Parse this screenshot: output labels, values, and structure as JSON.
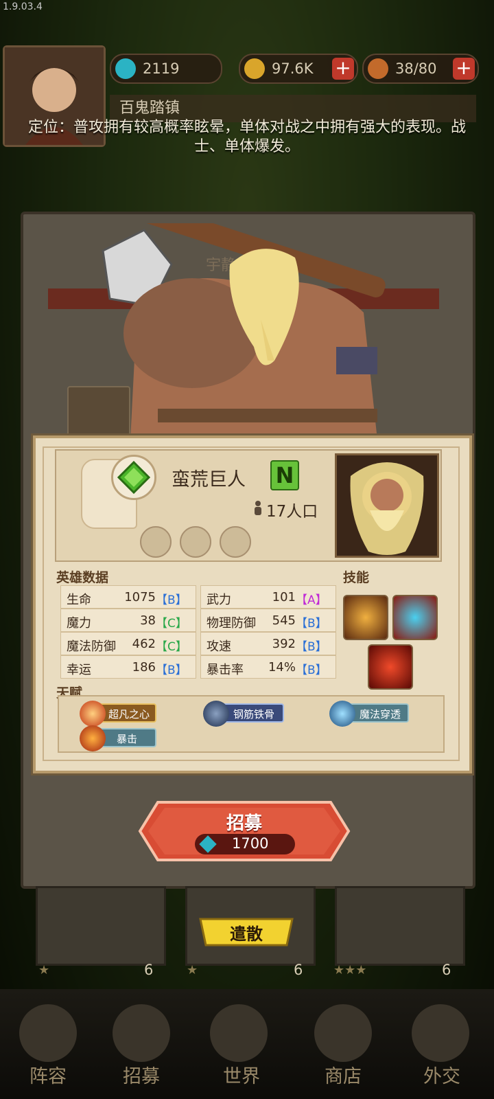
{
  "version": "1.9.03.4",
  "resources": {
    "diamonds": "2119",
    "gold": "97.6K",
    "food": "38/80",
    "plus": "+"
  },
  "location": "百鬼踏镇",
  "description": "定位：普攻拥有较高概率眩晕，单体对战之中拥有强大的表现。战士、单体爆发。",
  "back_panel_title": "宇静",
  "hero": {
    "name": "蛮荒巨人",
    "rarity": "N",
    "population": "17人口"
  },
  "stats_title": "英雄数据",
  "skills_title": "技能",
  "talents_title": "天赋",
  "stats": [
    {
      "name": "生命",
      "value": "1075",
      "grade": "【B】",
      "color": "#2a6fd6"
    },
    {
      "name": "武力",
      "value": "101",
      "grade": "【A】",
      "color": "#c02ad6"
    },
    {
      "name": "魔力",
      "value": "38",
      "grade": "【C】",
      "color": "#2aa84a"
    },
    {
      "name": "物理防御",
      "value": "545",
      "grade": "【B】",
      "color": "#2a6fd6"
    },
    {
      "name": "魔法防御",
      "value": "462",
      "grade": "【C】",
      "color": "#2aa84a"
    },
    {
      "name": "攻速",
      "value": "392",
      "grade": "【B】",
      "color": "#2a6fd6"
    },
    {
      "name": "幸运",
      "value": "186",
      "grade": "【B】",
      "color": "#2a6fd6"
    },
    {
      "name": "暴击率",
      "value": "14%",
      "grade": "【B】",
      "color": "#2a6fd6"
    }
  ],
  "talents": [
    "超凡之心",
    "钢筋铁骨",
    "魔法穿透",
    "暴击"
  ],
  "recruit": {
    "label": "招募",
    "cost": "1700"
  },
  "dismiss": "遣散",
  "bottom_cards": [
    {
      "count": "6"
    },
    {
      "count": "6"
    },
    {
      "count": "6"
    }
  ],
  "nav": [
    "阵容",
    "招募",
    "世界",
    "商店",
    "外交"
  ]
}
